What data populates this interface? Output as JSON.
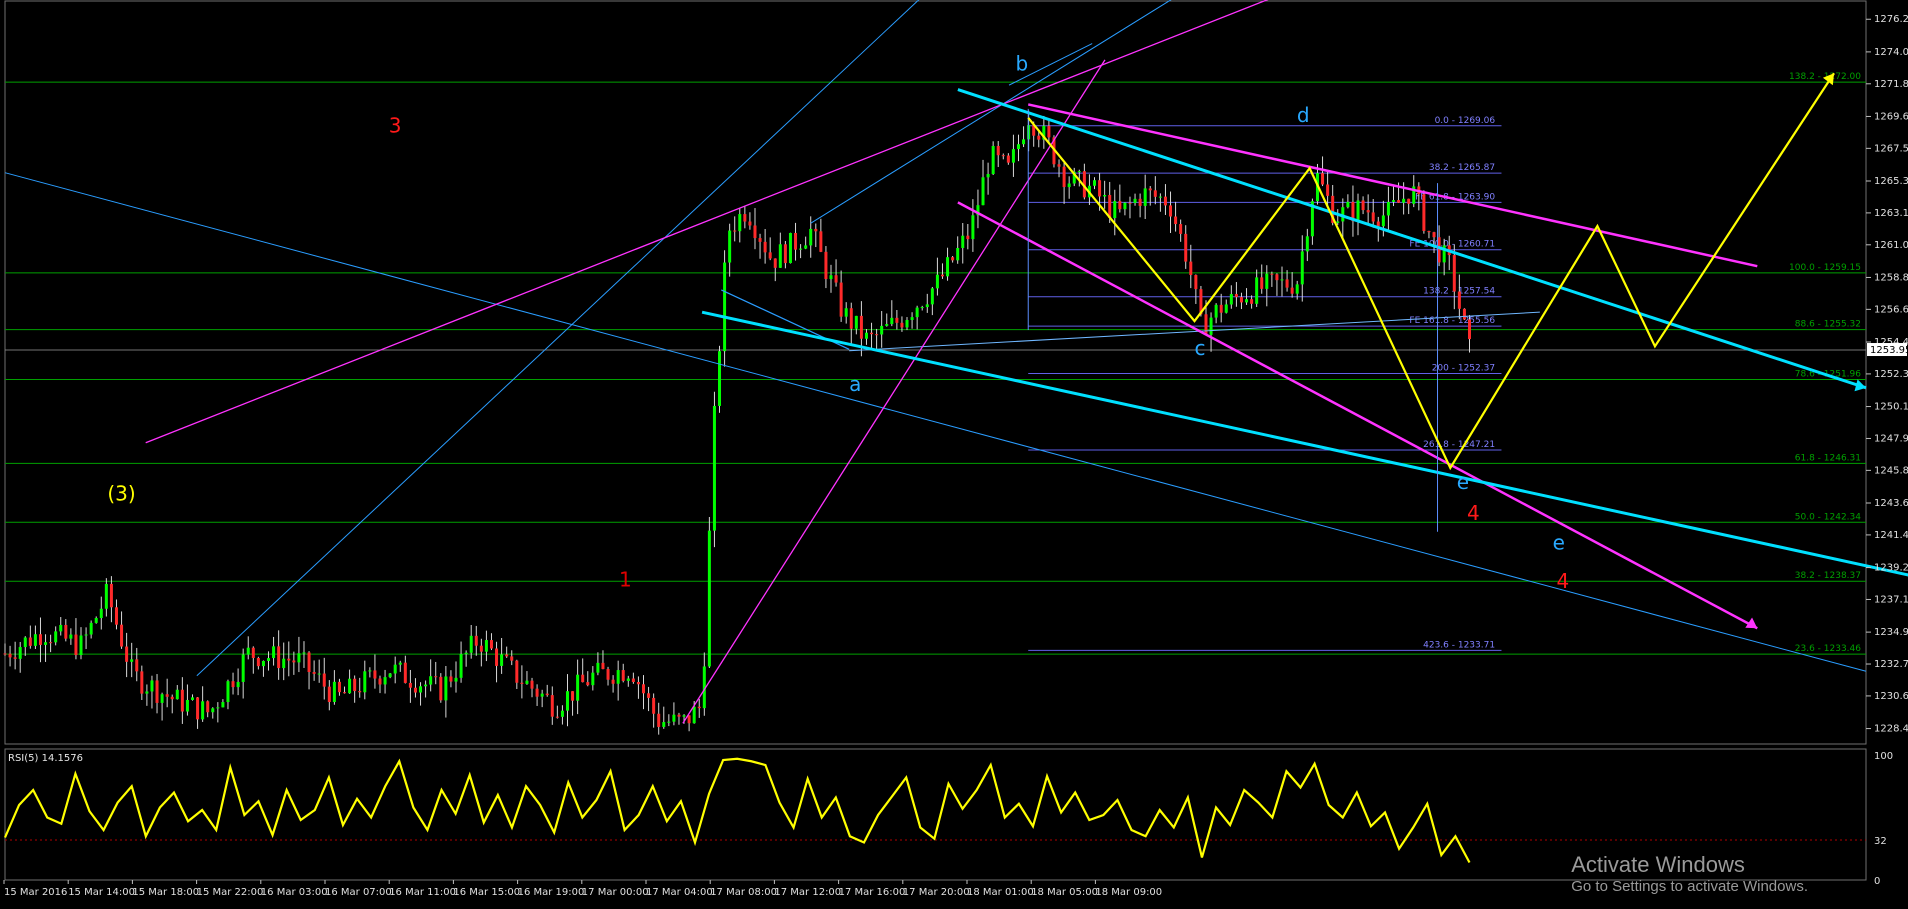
{
  "chart_data": {
    "type": "candlestick",
    "price_axis": {
      "ticks": [
        "1276.24",
        "1274.04",
        "1271.89",
        "1269.69",
        "1267.54",
        "1265.34",
        "1263.19",
        "1261.04",
        "1258.84",
        "1256.69",
        "1254.49",
        "1252.34",
        "1250.14",
        "1247.99",
        "1245.84",
        "1243.64",
        "1241.49",
        "1239.29",
        "1237.14",
        "1234.94",
        "1232.79",
        "1230.64",
        "1228.44"
      ],
      "ylim": [
        1227.4,
        1277.2
      ],
      "current_price": "1253.95"
    },
    "time_axis": {
      "labels": [
        "15 Mar 2016",
        "15 Mar 14:00",
        "15 Mar 18:00",
        "15 Mar 22:00",
        "16 Mar 03:00",
        "16 Mar 07:00",
        "16 Mar 11:00",
        "16 Mar 15:00",
        "16 Mar 19:00",
        "17 Mar 00:00",
        "17 Mar 04:00",
        "17 Mar 08:00",
        "17 Mar 12:00",
        "17 Mar 16:00",
        "17 Mar 20:00",
        "18 Mar 01:00",
        "18 Mar 05:00",
        "18 Mar 09:00"
      ]
    },
    "fib_levels_right": [
      {
        "label": "138.2 - 1272.00",
        "price": 1272.0
      },
      {
        "label": "100.0 - 1259.15",
        "price": 1259.15
      },
      {
        "label": "88.6 - 1255.32",
        "price": 1255.32
      },
      {
        "label": "78.6 - 1251.96",
        "price": 1251.96
      },
      {
        "label": "61.8 - 1246.31",
        "price": 1246.31
      },
      {
        "label": "50.0 - 1242.34",
        "price": 1242.34
      },
      {
        "label": "38.2 - 1238.37",
        "price": 1238.37
      },
      {
        "label": "23.6 - 1233.46",
        "price": 1233.46
      }
    ],
    "fib_levels_inner": [
      {
        "label": "0.0 - 1269.06",
        "price": 1269.06
      },
      {
        "label": "38.2 - 1265.87",
        "price": 1265.87
      },
      {
        "label": "FE 61.8 - 1263.90",
        "price": 1263.9
      },
      {
        "label": "FE 100.0 - 1260.71",
        "price": 1260.71
      },
      {
        "label": "138.2 - 1257.54",
        "price": 1257.54
      },
      {
        "label": "FE 161.8 - 1255.56",
        "price": 1255.56
      },
      {
        "label": "200 - 1252.37",
        "price": 1252.37
      },
      {
        "label": "261.8 - 1247.21",
        "price": 1247.21
      },
      {
        "label": "423.6 - 1233.71",
        "price": 1233.71
      }
    ],
    "wave_labels": [
      {
        "text": "3",
        "color": "#ff1a1a",
        "t": 0.3,
        "price": 1268.6
      },
      {
        "text": "(3)",
        "color": "#ffff00",
        "t": 0.08,
        "price": 1243.8
      },
      {
        "text": "1",
        "color": "#e00000",
        "t": 0.48,
        "price": 1238.0
      },
      {
        "text": "b",
        "color": "#29a9ff",
        "t": 0.79,
        "price": 1272.8
      },
      {
        "text": "d",
        "color": "#29a9ff",
        "t": 1.01,
        "price": 1269.3
      },
      {
        "text": "a",
        "color": "#29a9ff",
        "t": 0.66,
        "price": 1251.2
      },
      {
        "text": "c",
        "color": "#29a9ff",
        "t": 0.93,
        "price": 1253.6
      },
      {
        "text": "e",
        "color": "#29a9ff",
        "t": 1.135,
        "price": 1244.6
      },
      {
        "text": "e",
        "color": "#29a9ff",
        "t": 1.21,
        "price": 1240.5
      },
      {
        "text": "4",
        "color": "#ff1a1a",
        "t": 1.143,
        "price": 1242.5
      },
      {
        "text": "4",
        "color": "#ff1a1a",
        "t": 1.213,
        "price": 1237.9
      }
    ],
    "rsi": {
      "label": "RSI(5) 14.1576",
      "ticks": [
        "100",
        "32",
        "0"
      ],
      "level": 32,
      "ylim": [
        0,
        100
      ],
      "values": [
        34,
        60,
        72,
        50,
        45,
        85,
        55,
        40,
        62,
        75,
        35,
        58,
        70,
        47,
        56,
        40,
        90,
        52,
        63,
        36,
        72,
        48,
        56,
        82,
        44,
        65,
        50,
        75,
        95,
        58,
        40,
        72,
        53,
        84,
        46,
        68,
        42,
        75,
        60,
        38,
        78,
        50,
        64,
        87,
        40,
        52,
        75,
        47,
        63,
        30,
        69,
        96,
        97,
        95,
        92,
        62,
        42,
        81,
        50,
        66,
        35,
        30,
        52,
        67,
        82,
        42,
        33,
        77,
        57,
        72,
        92,
        50,
        61,
        43,
        83,
        54,
        70,
        48,
        52,
        64,
        40,
        35,
        56,
        42,
        66,
        18,
        58,
        44,
        72,
        62,
        50,
        87,
        74,
        93,
        60,
        50,
        70,
        43,
        54,
        25,
        42,
        61,
        20,
        35,
        14
      ]
    },
    "colors": {
      "candle_up": "#00ff00",
      "candle_down": "#ff2a2a",
      "wick": "#d9d9d9",
      "grid_green": "#00a000",
      "fib_inner": "#6060e8",
      "fib_label": "#8080ff",
      "cyan": "#00e0ff",
      "blue": "#2a9dff",
      "magenta": "#ff33ff",
      "yellow": "#ffff00",
      "rsi_line": "#ffff00",
      "axis_text": "#e0e0e0"
    }
  },
  "watermark": {
    "title": "Activate Windows",
    "subtitle": "Go to Settings to activate Windows."
  }
}
